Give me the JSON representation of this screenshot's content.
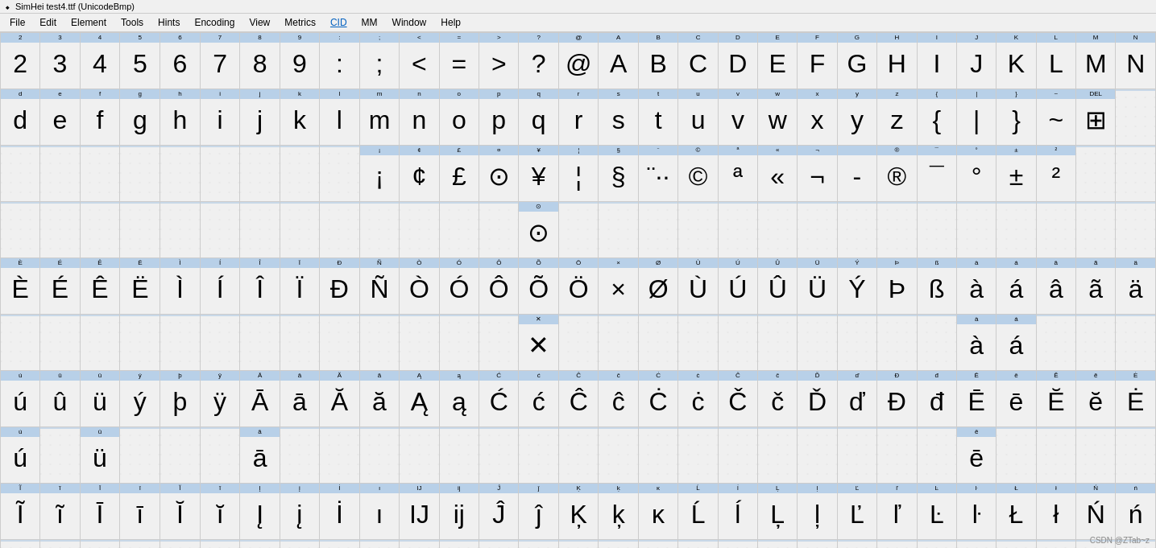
{
  "title_bar": {
    "icon": "♦",
    "text": "SimHei  test4.ttf (UnicodeBmp)"
  },
  "menu_bar": {
    "items": [
      {
        "label": "File",
        "active": false
      },
      {
        "label": "Edit",
        "active": false
      },
      {
        "label": "Element",
        "active": false
      },
      {
        "label": "Tools",
        "active": false
      },
      {
        "label": "Hints",
        "active": false
      },
      {
        "label": "Encoding",
        "active": false
      },
      {
        "label": "View",
        "active": false
      },
      {
        "label": "Metrics",
        "active": false
      },
      {
        "label": "CID",
        "active": true
      },
      {
        "label": "MM",
        "active": false
      },
      {
        "label": "Window",
        "active": false
      },
      {
        "label": "Help",
        "active": false
      }
    ]
  },
  "watermark": "CSDN @ZTab~z",
  "rows": [
    {
      "cells": [
        {
          "code": "2",
          "char": "2",
          "empty": false
        },
        {
          "code": "3",
          "char": "3",
          "empty": false
        },
        {
          "code": "4",
          "char": "4",
          "empty": false
        },
        {
          "code": "5",
          "char": "5",
          "empty": false
        },
        {
          "code": "6",
          "char": "6",
          "empty": false
        },
        {
          "code": "7",
          "char": "7",
          "empty": false
        },
        {
          "code": "8",
          "char": "8",
          "empty": false
        },
        {
          "code": "9",
          "char": "9",
          "empty": false
        },
        {
          "code": ":",
          "char": ":",
          "empty": false
        },
        {
          "code": ";",
          "char": ";",
          "empty": false
        },
        {
          "code": "<",
          "char": "<",
          "empty": false
        },
        {
          "code": "=",
          "char": "=",
          "empty": false
        },
        {
          "code": ">",
          "char": ">",
          "empty": false
        },
        {
          "code": "?",
          "char": "?",
          "empty": false
        },
        {
          "code": "@",
          "char": "@",
          "empty": false
        },
        {
          "code": "A",
          "char": "A",
          "empty": false
        },
        {
          "code": "B",
          "char": "B",
          "empty": false
        },
        {
          "code": "C",
          "char": "C",
          "empty": false
        },
        {
          "code": "D",
          "char": "D",
          "empty": false
        },
        {
          "code": "E",
          "char": "E",
          "empty": false
        },
        {
          "code": "F",
          "char": "F",
          "empty": false
        },
        {
          "code": "G",
          "char": "G",
          "empty": false
        },
        {
          "code": "H",
          "char": "H",
          "empty": false
        },
        {
          "code": "I",
          "char": "I",
          "empty": false
        },
        {
          "code": "J",
          "char": "J",
          "empty": false
        },
        {
          "code": "K",
          "char": "K",
          "empty": false
        },
        {
          "code": "L",
          "char": "L",
          "empty": false
        },
        {
          "code": "M",
          "char": "M",
          "empty": false
        },
        {
          "code": "N",
          "char": "N",
          "empty": false
        }
      ]
    },
    {
      "cells": [
        {
          "code": "d",
          "char": "d",
          "empty": false
        },
        {
          "code": "e",
          "char": "e",
          "empty": false
        },
        {
          "code": "f",
          "char": "f",
          "empty": false
        },
        {
          "code": "g",
          "char": "g",
          "empty": false
        },
        {
          "code": "h",
          "char": "h",
          "empty": false
        },
        {
          "code": "i",
          "char": "i",
          "empty": false
        },
        {
          "code": "j",
          "char": "j",
          "empty": false
        },
        {
          "code": "k",
          "char": "k",
          "empty": false
        },
        {
          "code": "l",
          "char": "l",
          "empty": false
        },
        {
          "code": "m",
          "char": "m",
          "empty": false
        },
        {
          "code": "n",
          "char": "n",
          "empty": false
        },
        {
          "code": "o",
          "char": "o",
          "empty": false
        },
        {
          "code": "p",
          "char": "p",
          "empty": false
        },
        {
          "code": "q",
          "char": "q",
          "empty": false
        },
        {
          "code": "r",
          "char": "r",
          "empty": false
        },
        {
          "code": "s",
          "char": "s",
          "empty": false
        },
        {
          "code": "t",
          "char": "t",
          "empty": false
        },
        {
          "code": "u",
          "char": "u",
          "empty": false
        },
        {
          "code": "v",
          "char": "v",
          "empty": false
        },
        {
          "code": "w",
          "char": "w",
          "empty": false
        },
        {
          "code": "x",
          "char": "x",
          "empty": false
        },
        {
          "code": "y",
          "char": "y",
          "empty": false
        },
        {
          "code": "z",
          "char": "z",
          "empty": false
        },
        {
          "code": "{",
          "char": "{",
          "empty": false
        },
        {
          "code": "|",
          "char": "|",
          "empty": false
        },
        {
          "code": "}",
          "char": "}",
          "empty": false
        },
        {
          "code": "~",
          "char": "~",
          "empty": false
        },
        {
          "code": "▦",
          "char": "▦",
          "empty": false
        },
        {
          "code": "",
          "char": "",
          "empty": true
        }
      ]
    },
    {
      "cells": [
        {
          "code": "",
          "char": "",
          "empty": true
        },
        {
          "code": "",
          "char": "",
          "empty": true
        },
        {
          "code": "",
          "char": "",
          "empty": true
        },
        {
          "code": "",
          "char": "",
          "empty": true
        },
        {
          "code": "",
          "char": "",
          "empty": true
        },
        {
          "code": "",
          "char": "",
          "empty": true
        },
        {
          "code": "",
          "char": "",
          "empty": true
        },
        {
          "code": "",
          "char": "",
          "empty": true
        },
        {
          "code": "",
          "char": "",
          "empty": true
        },
        {
          "code": "¡",
          "char": "¡",
          "empty": false
        },
        {
          "code": "¢",
          "char": "¢",
          "empty": false
        },
        {
          "code": "£",
          "char": "£",
          "empty": false
        },
        {
          "code": "¤",
          "char": "¤",
          "empty": false
        },
        {
          "code": "¥",
          "char": "¥",
          "empty": false
        },
        {
          "code": "¦",
          "char": "¦",
          "empty": false
        },
        {
          "code": "§",
          "char": "§",
          "empty": false
        },
        {
          "code": "¨",
          "char": "¨..",
          "empty": false
        },
        {
          "code": "©",
          "char": "©",
          "empty": false
        },
        {
          "code": "ª",
          "char": "ª",
          "empty": false
        },
        {
          "code": "«",
          "char": "«",
          "empty": false
        },
        {
          "code": "¬",
          "char": "¬",
          "empty": false
        },
        {
          "code": "­",
          "char": "-",
          "empty": false
        },
        {
          "code": "®",
          "char": "®",
          "empty": false
        },
        {
          "code": "¯",
          "char": "¯",
          "empty": false
        },
        {
          "code": "°",
          "char": "°",
          "empty": false
        },
        {
          "code": "±",
          "char": "±",
          "empty": false
        },
        {
          "code": "²",
          "char": "²",
          "empty": false
        },
        {
          "code": "",
          "char": "",
          "empty": true
        },
        {
          "code": "",
          "char": "",
          "empty": true
        }
      ]
    }
  ]
}
